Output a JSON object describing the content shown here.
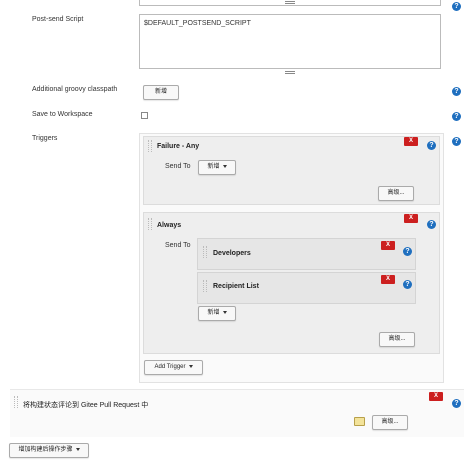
{
  "post_send_script": {
    "label": "Post-send Script",
    "value": "$DEFAULT_POSTSEND_SCRIPT"
  },
  "groovy_classpath": {
    "label": "Additional groovy classpath",
    "add_button": "新增"
  },
  "save_to_workspace": {
    "label": "Save to Workspace"
  },
  "triggers": {
    "label": "Triggers",
    "failure_any": {
      "title": "Failure - Any",
      "send_to_label": "Send To",
      "add_button": "新增",
      "advanced_button": "高级..."
    },
    "always": {
      "title": "Always",
      "send_to_label": "Send To",
      "developers": "Developers",
      "recipient_list": "Recipient List",
      "add_button": "新增",
      "advanced_button": "高级..."
    },
    "add_trigger_button": "Add Trigger"
  },
  "gitee_step": {
    "title": "将构建状态评论到 Gitee Pull Request 中",
    "advanced_button": "高级..."
  },
  "add_post_build_step": "增加构建后操作步骤",
  "icons": {
    "help": "?",
    "delete": "X"
  },
  "colors": {
    "help": "#1f6fbf",
    "delete": "#cc1f1f"
  }
}
